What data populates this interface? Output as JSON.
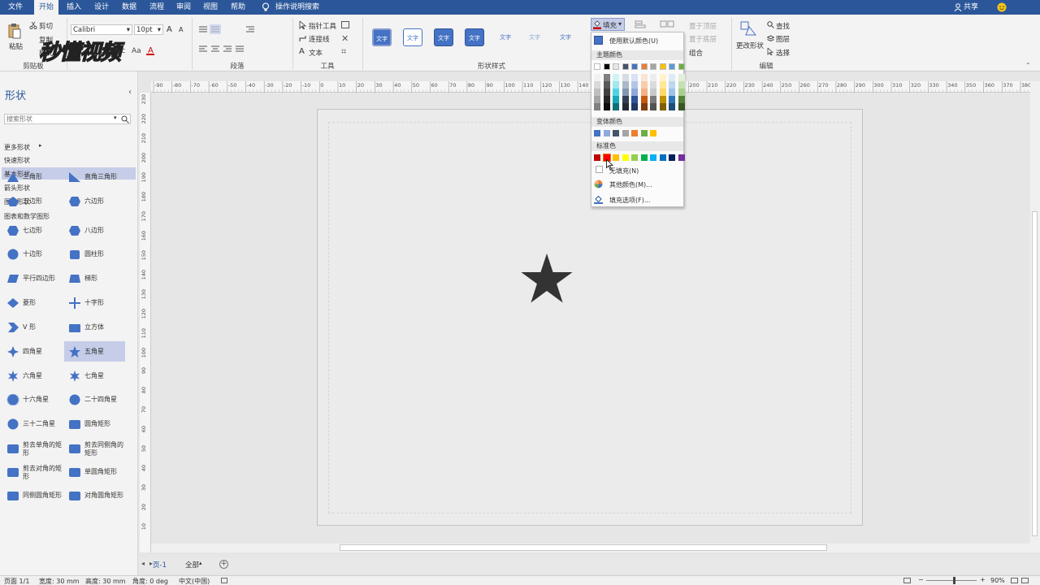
{
  "menubar": {
    "tabs": [
      "文件",
      "开始",
      "插入",
      "设计",
      "数据",
      "流程",
      "审阅",
      "视图",
      "帮助"
    ],
    "active_tab": "开始",
    "tell_me": "操作说明搜索",
    "share": "共享"
  },
  "ribbon": {
    "clipboard": {
      "paste": "粘贴",
      "cut": "剪切",
      "copy": "复制",
      "format": "格式",
      "label": "剪贴板"
    },
    "font": {
      "name": "Calibri",
      "size": "10pt",
      "grow": "A",
      "shrink": "A"
    },
    "paragraph_label": "段落",
    "tools": {
      "pointer": "指针工具",
      "connector": "连接线",
      "text": "文本",
      "label": "工具"
    },
    "shape_styles": {
      "label": "形状样式",
      "style_text": "文字"
    },
    "fill_button": "填充",
    "arrange": {
      "bring_front": "置于顶层",
      "send_back": "置于底层",
      "group": "组合"
    },
    "editing": {
      "change_shape": "更改形状",
      "find": "查找",
      "layers": "图层",
      "select": "选择",
      "label": "编辑"
    }
  },
  "watermark": "秒懂视频",
  "leftpanel": {
    "title": "形状",
    "search_placeholder": "搜索形状",
    "categories": [
      "更多形状",
      "快速形状",
      "基本形状",
      "箭头形状",
      "图案形状",
      "图表和数学图形"
    ],
    "selected_category": "基本形状",
    "shapes": [
      [
        "三角形",
        "直角三角形"
      ],
      [
        "五边形",
        "六边形"
      ],
      [
        "七边形",
        "八边形"
      ],
      [
        "十边形",
        "圆柱形"
      ],
      [
        "平行四边形",
        "梯形"
      ],
      [
        "菱形",
        "十字形"
      ],
      [
        "V 形",
        "立方体"
      ],
      [
        "四角星",
        "五角星"
      ],
      [
        "六角星",
        "七角星"
      ],
      [
        "十六角星",
        "二十四角星"
      ],
      [
        "三十二角星",
        "圆角矩形"
      ],
      [
        "剪去单角的矩形",
        "剪去同侧角的矩形"
      ],
      [
        "剪去对角的矩形",
        "单圆角矩形"
      ],
      [
        "同侧圆角矩形",
        "对角圆角矩形"
      ]
    ],
    "selected_shape": "五角星"
  },
  "ruler": {
    "h_ticks": [
      "-90",
      "-80",
      "-70",
      "-60",
      "-50",
      "-40",
      "-30",
      "-20",
      "-10",
      "0",
      "10",
      "20",
      "30",
      "40",
      "50",
      "60",
      "70",
      "80",
      "90",
      "100",
      "110",
      "120",
      "130",
      "140",
      "150",
      "160",
      "170",
      "180",
      "190",
      "200",
      "210",
      "220",
      "230",
      "240",
      "250",
      "260",
      "270",
      "280",
      "290",
      "300",
      "310",
      "320",
      "330",
      "340",
      "350",
      "360",
      "370",
      "380"
    ],
    "v_ticks": [
      "230",
      "220",
      "210",
      "200",
      "190",
      "180",
      "170",
      "160",
      "150",
      "140",
      "130",
      "120",
      "110",
      "100",
      "90",
      "80",
      "70",
      "60",
      "50",
      "40",
      "30",
      "20",
      "10"
    ]
  },
  "dropdown": {
    "use_default": "使用默认颜色(U)",
    "theme_colors": "主题颜色",
    "variant_colors": "变体颜色",
    "standard_colors": "标准色",
    "no_fill": "无填充(N)",
    "more_colors": "其他颜色(M)...",
    "fill_options": "填充选项(F)...",
    "theme_top": [
      "#ffffff",
      "#000000",
      "#e7e6e6",
      "#44546a",
      "#4472c4",
      "#ed7d31",
      "#a5a5a5",
      "#ffc000",
      "#5b9bd5",
      "#70ad47"
    ],
    "theme_cols": [
      [
        "#f2f2f2",
        "#d9d9d9",
        "#bfbfbf",
        "#a6a6a6",
        "#808080"
      ],
      [
        "#808080",
        "#595959",
        "#404040",
        "#262626",
        "#0d0d0d"
      ],
      [
        "#d0f3f6",
        "#a1e7ee",
        "#4dd5e3",
        "#17a8b8",
        "#0e707b"
      ],
      [
        "#d6dce4",
        "#adb9ca",
        "#8497b0",
        "#333f50",
        "#222a35"
      ],
      [
        "#d9e2f3",
        "#b4c6e7",
        "#8eaadb",
        "#2f5597",
        "#1f3864"
      ],
      [
        "#fbe5d5",
        "#f8cbad",
        "#f4b183",
        "#c55a11",
        "#833c0b"
      ],
      [
        "#ededed",
        "#dbdbdb",
        "#c9c9c9",
        "#7b7b7b",
        "#525252"
      ],
      [
        "#fff2cc",
        "#ffe699",
        "#ffd966",
        "#bf9000",
        "#7f6000"
      ],
      [
        "#deebf6",
        "#bdd7ee",
        "#9dc3e6",
        "#2e75b5",
        "#1f4e79"
      ],
      [
        "#e2efd9",
        "#c5e0b3",
        "#a8d08d",
        "#538135",
        "#375623"
      ]
    ],
    "variant": [
      "#4472c4",
      "#8faadc",
      "#44546a",
      "#a5a5a5",
      "#ed7d31",
      "#70ad47",
      "#ffc000"
    ],
    "standard": [
      "#c00000",
      "#ff0000",
      "#ffc000",
      "#ffff00",
      "#92d050",
      "#00b050",
      "#00b0f0",
      "#0070c0",
      "#002060",
      "#7030a0"
    ]
  },
  "canvas": {
    "star_color": "#333333"
  },
  "tabs": {
    "page": "页-1",
    "all": "全部"
  },
  "status": {
    "page": "页面 1/1",
    "width": "宽度: 30 mm",
    "height": "高度: 30 mm",
    "angle": "角度: 0 deg",
    "lang": "中文(中国)",
    "zoom": "90%"
  },
  "colors": {
    "accent": "#2b579a",
    "shape_blue": "#4472c4",
    "selected_bg": "#c5cde8"
  }
}
